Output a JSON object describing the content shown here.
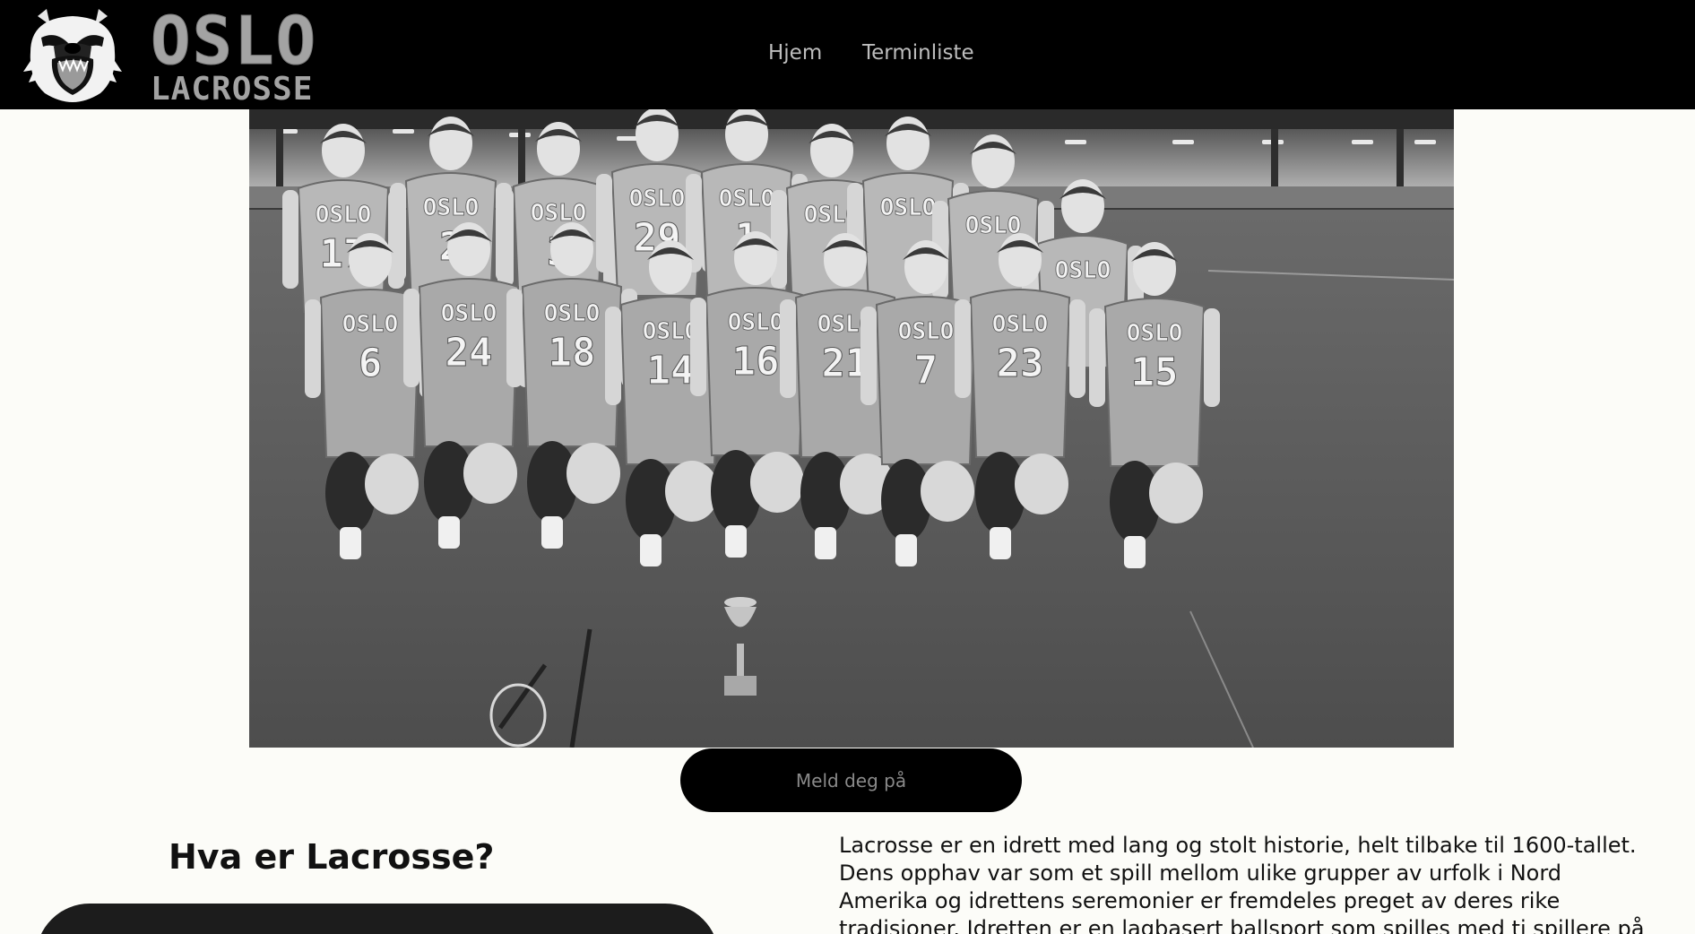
{
  "header": {
    "logo_line1": "OSLO",
    "logo_line2": "LACROSSE",
    "logo_icon": "bear-mascot-icon",
    "nav": [
      {
        "label": "Hjem"
      },
      {
        "label": "Terminliste"
      }
    ]
  },
  "hero": {
    "back_row_numbers": [
      "17",
      "2",
      "3",
      "29",
      "1"
    ],
    "front_row_numbers": [
      "6",
      "24",
      "18",
      "14",
      "16",
      "21",
      "7",
      "23",
      "15"
    ],
    "jersey_text": "OSLO"
  },
  "cta": {
    "label": "Meld deg på"
  },
  "about": {
    "heading": "Hva er Lacrosse?",
    "paragraph": "Lacrosse er en idrett med lang og stolt historie, helt tilbake til 1600-tallet. Dens opphav var som et spill mellom ulike grupper av urfolk i Nord Amerika og idrettens seremonier er fremdeles preget av deres rike tradisjoner. Idretten er en lagbasert ballsport som spilles med ti spillere på hvert lag, på"
  },
  "colors": {
    "header_bg": "#000000",
    "page_bg": "#fcfcf8",
    "nav_text": "#bdbdbd",
    "logo_text": "#a3a3a3",
    "button_bg": "#000000",
    "button_text": "#8a8a8a"
  }
}
